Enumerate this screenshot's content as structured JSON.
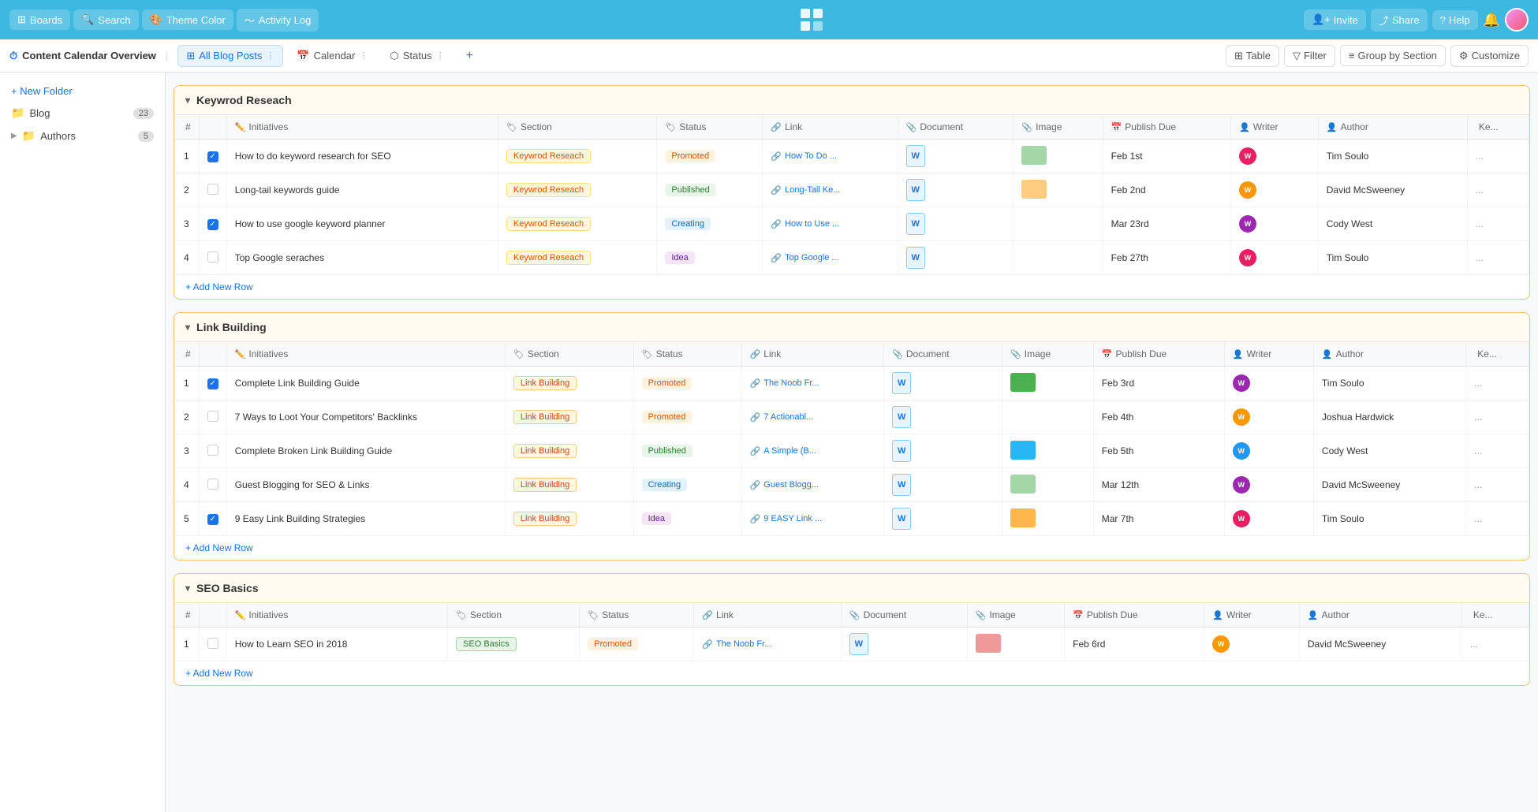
{
  "topNav": {
    "boards": "Boards",
    "search": "Search",
    "themeColor": "Theme Color",
    "activityLog": "Activity Log",
    "invite": "Invite",
    "share": "Share",
    "help": "Help"
  },
  "subNav": {
    "title": "Content Calendar Overview",
    "tabs": [
      {
        "label": "All Blog Posts",
        "active": true
      },
      {
        "label": "Calendar",
        "active": false
      },
      {
        "label": "Status",
        "active": false
      }
    ],
    "toolbar": {
      "table": "Table",
      "filter": "Filter",
      "groupBySection": "Group by Section",
      "customize": "Customize"
    }
  },
  "sidebar": {
    "newFolder": "+ New Folder",
    "items": [
      {
        "label": "Blog",
        "count": "23",
        "type": "folder"
      },
      {
        "label": "Authors",
        "count": "5",
        "type": "folder"
      }
    ]
  },
  "sections": [
    {
      "title": "Keywrod Reseach",
      "columns": [
        "#",
        "",
        "Initiatives",
        "Section",
        "Status",
        "Link",
        "Document",
        "Image",
        "Publish Due",
        "Writer",
        "Author",
        "Ke..."
      ],
      "rows": [
        {
          "num": "1",
          "checked": true,
          "initiative": "How to do keyword research for SEO",
          "section": "Keywrod Reseach",
          "sectionType": "kw",
          "status": "Promoted",
          "statusType": "promoted",
          "link": "How To Do ...",
          "publishDue": "Feb 1st",
          "writerColor": "#e91e63",
          "author": "Tim Soulo",
          "imgColor": "#a5d6a7"
        },
        {
          "num": "2",
          "checked": false,
          "initiative": "Long-tail keywords guide",
          "section": "Keywrod Reseach",
          "sectionType": "kw",
          "status": "Published",
          "statusType": "published",
          "link": "Long-Tail Ke...",
          "publishDue": "Feb 2nd",
          "writerColor": "#ff9800",
          "author": "David McSweeney",
          "imgColor": "#ffcc80"
        },
        {
          "num": "3",
          "checked": true,
          "initiative": "How to use google keyword planner",
          "section": "Keywrod Reseach",
          "sectionType": "kw",
          "status": "Creating",
          "statusType": "creating",
          "link": "How to Use ...",
          "publishDue": "Mar 23rd",
          "writerColor": "#9c27b0",
          "author": "Cody West",
          "imgColor": ""
        },
        {
          "num": "4",
          "checked": false,
          "initiative": "Top Google seraches",
          "section": "Keywrod Reseach",
          "sectionType": "kw",
          "status": "Idea",
          "statusType": "idea",
          "link": "Top Google ...",
          "publishDue": "Feb 27th",
          "writerColor": "#e91e63",
          "author": "Tim Soulo",
          "imgColor": ""
        }
      ],
      "addRow": "+ Add New Row"
    },
    {
      "title": "Link Building",
      "columns": [
        "#",
        "",
        "Initiatives",
        "Section",
        "Status",
        "Link",
        "Document",
        "Image",
        "Publish Due",
        "Writer",
        "Author",
        "Ke..."
      ],
      "rows": [
        {
          "num": "1",
          "checked": true,
          "initiative": "Complete Link Building Guide",
          "section": "Link Building",
          "sectionType": "lb",
          "status": "Promoted",
          "statusType": "promoted",
          "link": "The Noob Fr...",
          "publishDue": "Feb 3rd",
          "writerColor": "#9c27b0",
          "author": "Tim Soulo",
          "imgColor": "#4caf50"
        },
        {
          "num": "2",
          "checked": false,
          "initiative": "7 Ways to Loot Your Competitors' Backlinks",
          "section": "Link Building",
          "sectionType": "lb",
          "status": "Promoted",
          "statusType": "promoted",
          "link": "7 Actionabl...",
          "publishDue": "Feb 4th",
          "writerColor": "#ff9800",
          "author": "Joshua Hardwick",
          "imgColor": ""
        },
        {
          "num": "3",
          "checked": false,
          "initiative": "Complete Broken Link Building Guide",
          "section": "Link Building",
          "sectionType": "lb",
          "status": "Published",
          "statusType": "published",
          "link": "A Simple (B...",
          "publishDue": "Feb 5th",
          "writerColor": "#2196f3",
          "author": "Cody West",
          "imgColor": "#29b6f6"
        },
        {
          "num": "4",
          "checked": false,
          "initiative": "Guest Blogging for SEO & Links",
          "section": "Link Building",
          "sectionType": "lb",
          "status": "Creating",
          "statusType": "creating",
          "link": "Guest Blogg...",
          "publishDue": "Mar 12th",
          "writerColor": "#9c27b0",
          "author": "David McSweeney",
          "imgColor": "#a5d6a7"
        },
        {
          "num": "5",
          "checked": true,
          "initiative": "9 Easy Link Building Strategies",
          "section": "Link Building",
          "sectionType": "lb",
          "status": "Idea",
          "statusType": "idea",
          "link": "9 EASY Link ...",
          "publishDue": "Mar 7th",
          "writerColor": "#e91e63",
          "author": "Tim Soulo",
          "imgColor": "#ffb74d"
        }
      ],
      "addRow": "+ Add New Row"
    },
    {
      "title": "SEO Basics",
      "columns": [
        "#",
        "",
        "Initiatives",
        "Section",
        "Status",
        "Link",
        "Document",
        "Image",
        "Publish Due",
        "Writer",
        "Author",
        "Ke..."
      ],
      "rows": [
        {
          "num": "1",
          "checked": false,
          "initiative": "How to Learn SEO in 2018",
          "section": "SEO Basics",
          "sectionType": "sb",
          "status": "Promoted",
          "statusType": "promoted",
          "link": "The Noob Fr...",
          "publishDue": "Feb 6rd",
          "writerColor": "#ff9800",
          "author": "David McSweeney",
          "imgColor": "#ef9a9a"
        }
      ],
      "addRow": "+ Add New Row"
    }
  ]
}
